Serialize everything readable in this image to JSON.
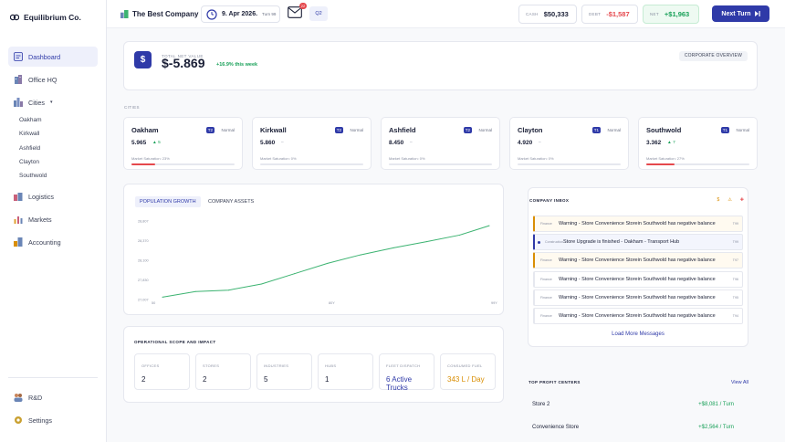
{
  "brand": {
    "name": "Equilibrium Co."
  },
  "sidebar": {
    "items": [
      {
        "label": "Dashboard"
      },
      {
        "label": "Office HQ"
      },
      {
        "label": "Cities",
        "suffix": "▾"
      },
      {
        "label": "Logistics"
      },
      {
        "label": "Markets"
      },
      {
        "label": "Accounting"
      }
    ],
    "city_sub": [
      "Oakham",
      "Kirkwall",
      "Ashfield",
      "Clayton",
      "Southwold"
    ],
    "bottom": [
      {
        "label": "R&D"
      },
      {
        "label": "Settings"
      }
    ]
  },
  "header": {
    "company": "The Best Company",
    "date": "9. Apr 2026.",
    "turn": "Turn 99",
    "inbox_badge": "22",
    "quarter": "Q2",
    "cash_label": "CASH",
    "cash_value": "$50,333",
    "debt_label": "DEBT",
    "debt_value": "-$1,587",
    "net_label": "NET",
    "net_value": "+$1,963",
    "next_turn": "Next Turn"
  },
  "hero": {
    "label": "TOTAL NET VALUE",
    "icon": "$",
    "value": "$-5.869",
    "delta": "+16.9% this week",
    "button": "CORPORATE OVERVIEW"
  },
  "cities_label": "CITIES",
  "cities": [
    {
      "name": "Oakham",
      "tier": "T2",
      "tier_label": "Normal",
      "value": "5.965",
      "change": "▲ 5",
      "change_color": "#18a058",
      "saturation": "Market Saturation: 23%",
      "sat_pct": 23
    },
    {
      "name": "Kirkwall",
      "tier": "T2",
      "tier_label": "Normal",
      "value": "5.860",
      "change": "–",
      "change_color": "#8a90a2",
      "saturation": "Market Saturation: 0%",
      "sat_pct": 0
    },
    {
      "name": "Ashfield",
      "tier": "T2",
      "tier_label": "Normal",
      "value": "8.450",
      "change": "–",
      "change_color": "#8a90a2",
      "saturation": "Market Saturation: 0%",
      "sat_pct": 0
    },
    {
      "name": "Clayton",
      "tier": "T1",
      "tier_label": "Normal",
      "value": "4.920",
      "change": "–",
      "change_color": "#8a90a2",
      "saturation": "Market Saturation: 0%",
      "sat_pct": 0
    },
    {
      "name": "Southwold",
      "tier": "T1",
      "tier_label": "Normal",
      "value": "3.362",
      "change": "▲ 7",
      "change_color": "#18a058",
      "saturation": "Market Saturation: 27%",
      "sat_pct": 27
    }
  ],
  "chart_tabs": [
    "POPULATION GROWTH",
    "COMPANY ASSETS"
  ],
  "chart_data": {
    "type": "line",
    "x": [
      0,
      10,
      20,
      30,
      40,
      50,
      60,
      70,
      80,
      90,
      99
    ],
    "values": [
      27000,
      27120,
      27150,
      27280,
      27500,
      27720,
      27900,
      28050,
      28180,
      28320,
      28520
    ],
    "ylim": [
      26950,
      28620
    ],
    "xlim": [
      0,
      99
    ],
    "y_ticks": [
      "28,807",
      "28,370",
      "28,100",
      "27,830",
      "27,007"
    ],
    "x_ticks": [
      "50",
      "80Y",
      "99Y"
    ],
    "color": "#3cb371"
  },
  "scope": {
    "title": "OPERATIONAL SCOPE AND IMPACT",
    "items": [
      {
        "label": "OFFICES",
        "value": "2",
        "color": "#1a1f36"
      },
      {
        "label": "STORES",
        "value": "2",
        "color": "#1a1f36"
      },
      {
        "label": "INDUSTRIES",
        "value": "5",
        "color": "#1a1f36"
      },
      {
        "label": "HUBS",
        "value": "1",
        "color": "#1a1f36"
      },
      {
        "label": "FLEET DISPATCH",
        "value": "6 Active Trucks",
        "color": "#2f3aa8"
      },
      {
        "label": "CONSUMED FUEL",
        "value": "343 L / Day",
        "color": "#d98e04"
      }
    ]
  },
  "inbox": {
    "title": "COMPANY INBOX",
    "filters": [
      "$",
      "⚠",
      "✚"
    ],
    "messages": [
      {
        "category": "Finance",
        "text": "Warning - Store Convenience Storein Southwold has negative balance",
        "time": "T99",
        "accent": "#d98e04",
        "bg": "#fffaf0"
      },
      {
        "category": "Construction",
        "text": "Store Upgrade is finished - Oakham - Transport Hub",
        "time": "T99",
        "accent": "#2f3aa8",
        "bg": "#f3f5fd"
      },
      {
        "category": "Finance",
        "text": "Warning - Store Convenience Storein Southwold has negative balance",
        "time": "T97",
        "accent": "#d98e04",
        "bg": "#fffaf0"
      },
      {
        "category": "Finance",
        "text": "Warning - Store Convenience Storein Southwold has negative balance",
        "time": "T96",
        "accent": "#e6e8ef",
        "bg": "#ffffff"
      },
      {
        "category": "Finance",
        "text": "Warning - Store Convenience Storein Southwold has negative balance",
        "time": "T95",
        "accent": "#e6e8ef",
        "bg": "#ffffff"
      },
      {
        "category": "Finance",
        "text": "Warning - Store Convenience Storein Southwold has negative balance",
        "time": "T94",
        "accent": "#e6e8ef",
        "bg": "#ffffff"
      }
    ],
    "load_more": "Load More Messages"
  },
  "profit": {
    "title": "TOP PROFIT CENTERS",
    "view_all": "View All",
    "rows": [
      {
        "name": "Store 2",
        "value": "+$8,081 / Turn"
      },
      {
        "name": "Convenience Store",
        "value": "+$2,564 / Turn"
      }
    ]
  }
}
